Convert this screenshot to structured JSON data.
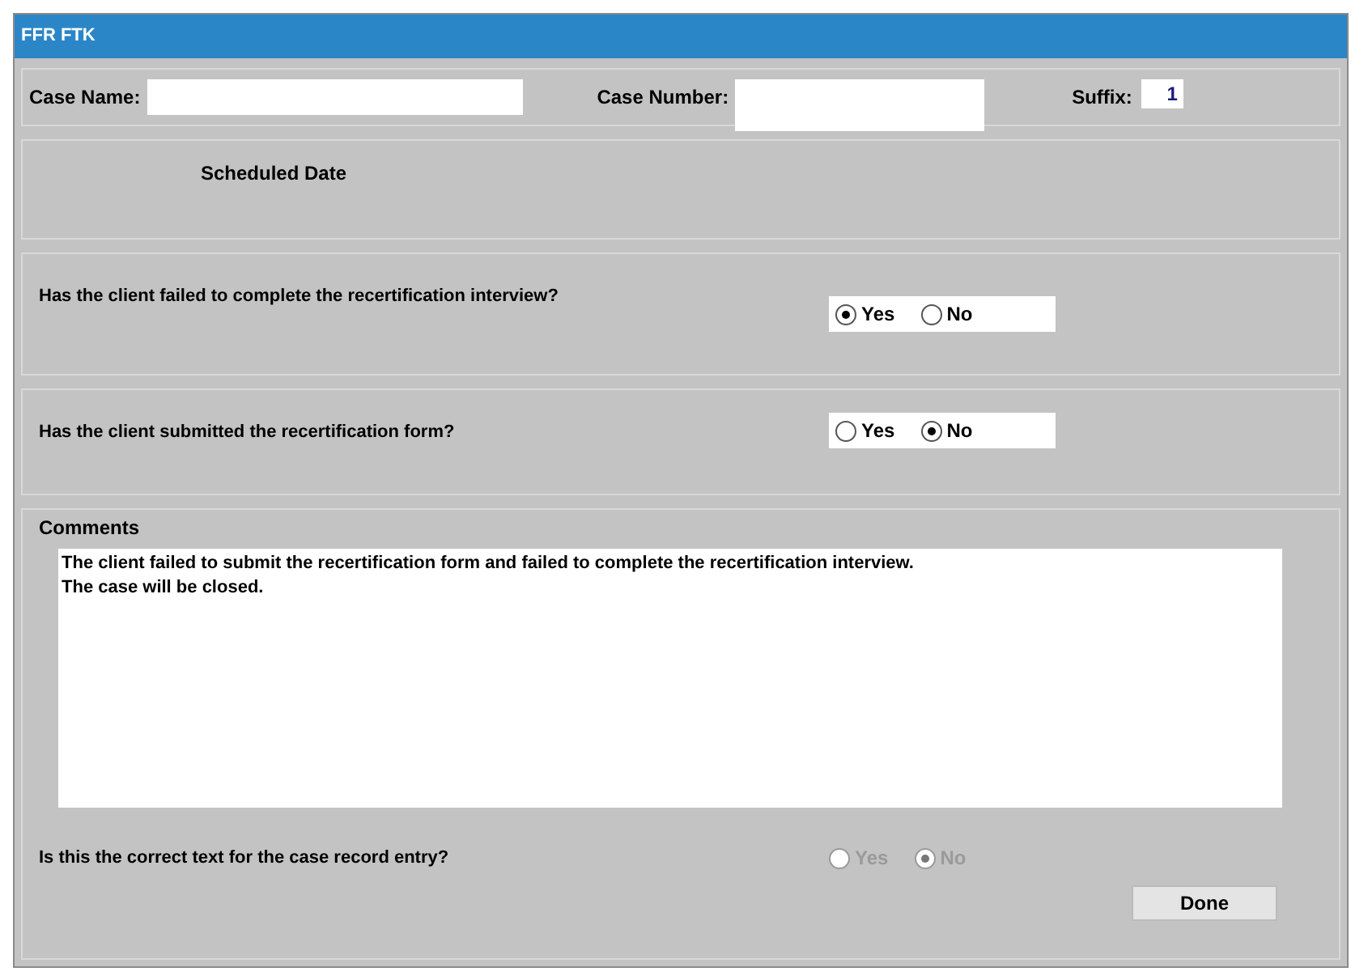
{
  "window": {
    "title": "FFR FTK"
  },
  "header": {
    "case_name_label": "Case Name:",
    "case_number_label": "Case Number:",
    "suffix_label": "Suffix:",
    "suffix_value": "1"
  },
  "scheduled_date": {
    "label": "Scheduled Date"
  },
  "questions": [
    {
      "text": "Has the client failed to complete the recertification interview?",
      "disabled": false,
      "options": [
        {
          "label": "Yes",
          "selected": true
        },
        {
          "label": "No",
          "selected": false
        }
      ]
    },
    {
      "text": "Has the client submitted the recertification form?",
      "disabled": false,
      "options": [
        {
          "label": "Yes",
          "selected": false
        },
        {
          "label": "No",
          "selected": true
        }
      ]
    }
  ],
  "comments": {
    "label": "Comments",
    "value": "The client failed to submit the recertification form and failed to complete the recertification interview.\nThe case will be closed."
  },
  "confirm": {
    "text": "Is this the correct text for the case record entry?",
    "disabled": true,
    "options": [
      {
        "label": "Yes",
        "selected": false
      },
      {
        "label": "No",
        "selected": true
      }
    ]
  },
  "done_button": "Done"
}
